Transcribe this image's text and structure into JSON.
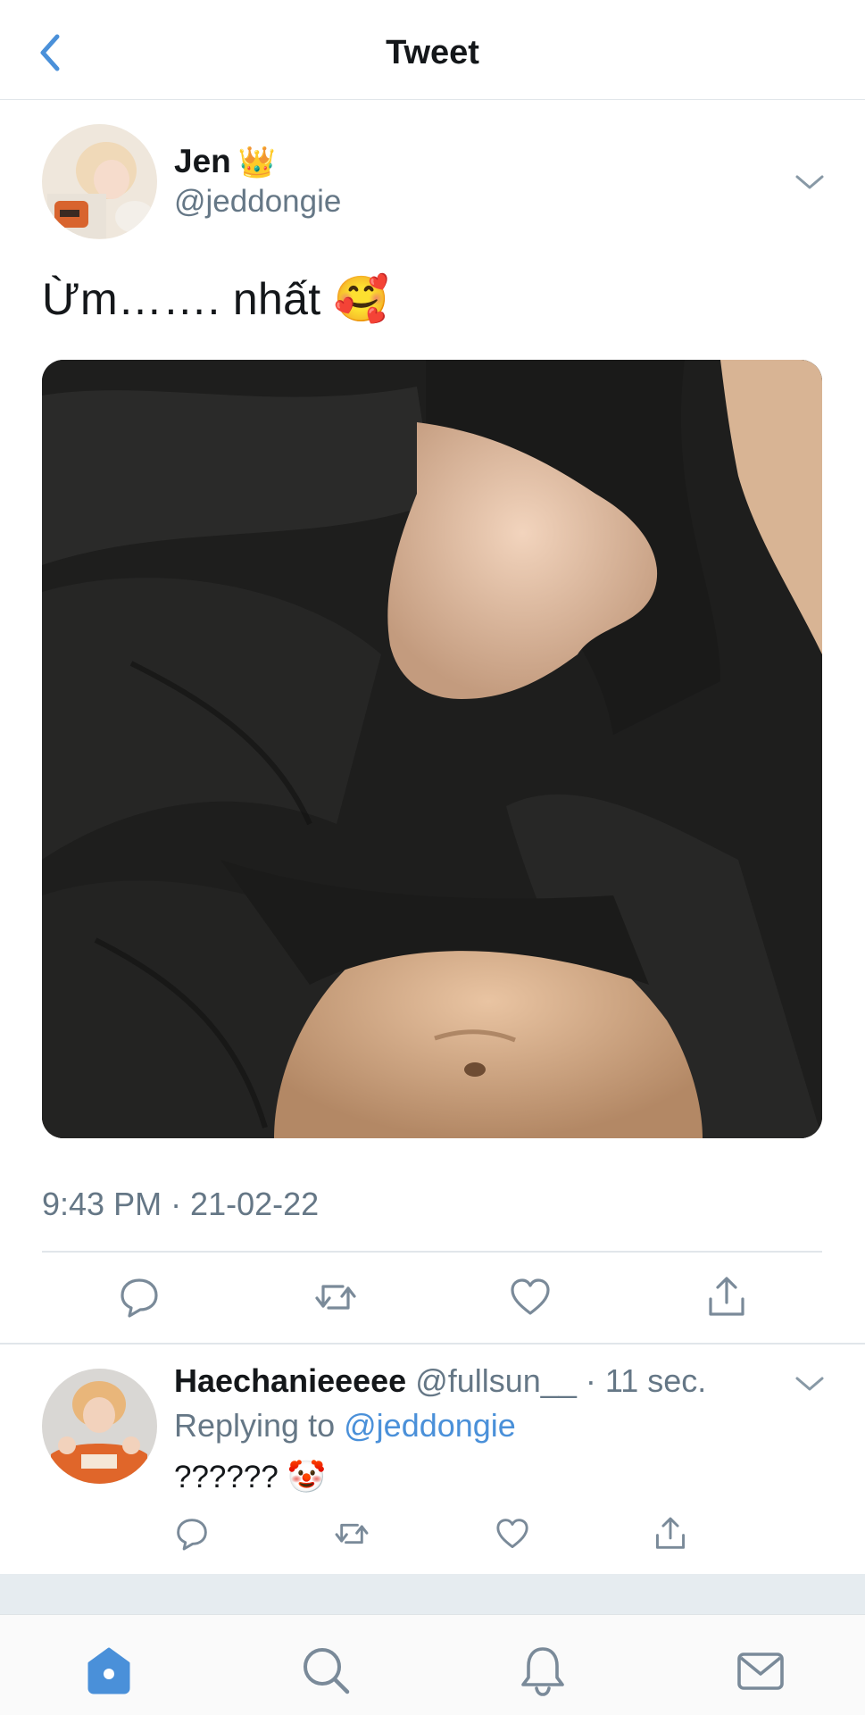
{
  "nav": {
    "title": "Tweet",
    "back_icon": "chevron-left-icon"
  },
  "tweet": {
    "author_name": "Jen",
    "author_badge": "👑",
    "author_handle": "@jeddongie",
    "text": "Ừm……. nhất 🥰",
    "timestamp": "9:43 PM · 21-02-22",
    "actions": [
      "reply-icon",
      "retweet-icon",
      "like-icon",
      "share-icon"
    ]
  },
  "reply": {
    "author_name": "Haechanieeeee",
    "author_handle": "@fullsun__",
    "time": "· 11 sec.",
    "replying_label": "Replying to",
    "replying_handle": "@jeddongie",
    "text": "?????? 🤡",
    "actions": [
      "reply-icon",
      "retweet-icon",
      "like-icon",
      "share-icon"
    ]
  },
  "tabbar": {
    "items": [
      "home-icon",
      "search-icon",
      "notifications-icon",
      "messages-icon"
    ],
    "active": "home-icon"
  },
  "colors": {
    "accent": "#4a90d9",
    "secondary_text": "#657786",
    "divider": "#e1e6ea",
    "icon": "#7a8a99"
  }
}
